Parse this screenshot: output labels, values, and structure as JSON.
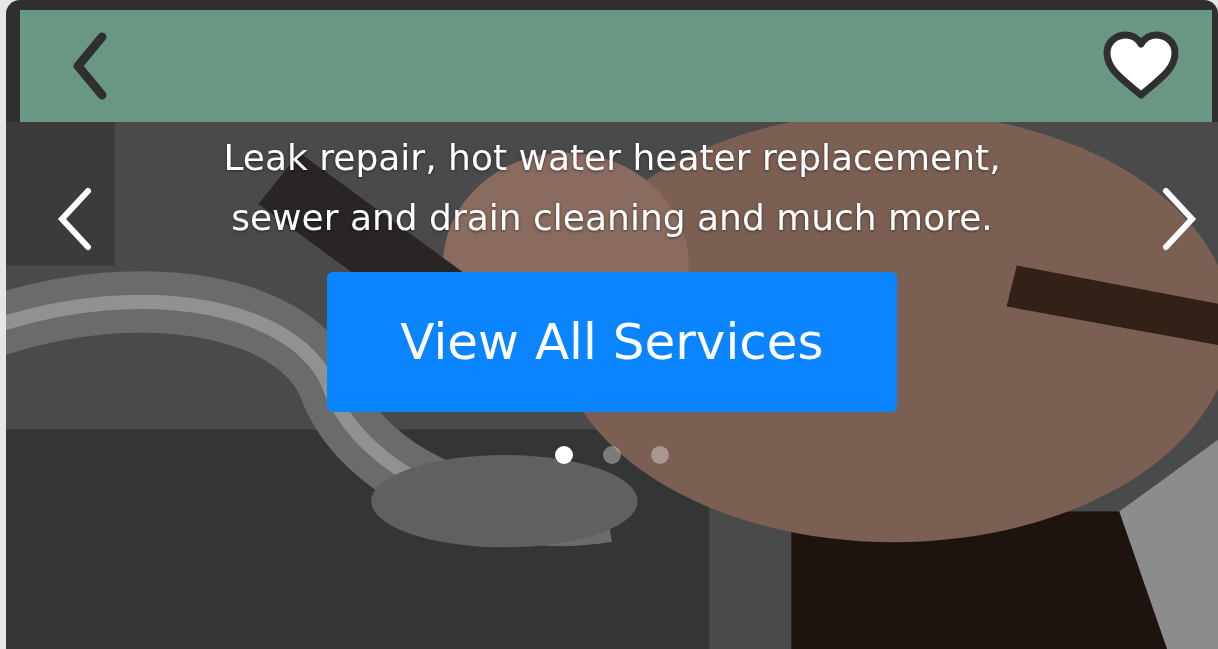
{
  "slider": {
    "text": "Leak repair, hot water heater replacement, sewer and drain cleaning and much more.",
    "button": "View All Services",
    "dots": [
      {
        "selected": true
      },
      {
        "selected": false
      },
      {
        "selected": false
      }
    ]
  }
}
